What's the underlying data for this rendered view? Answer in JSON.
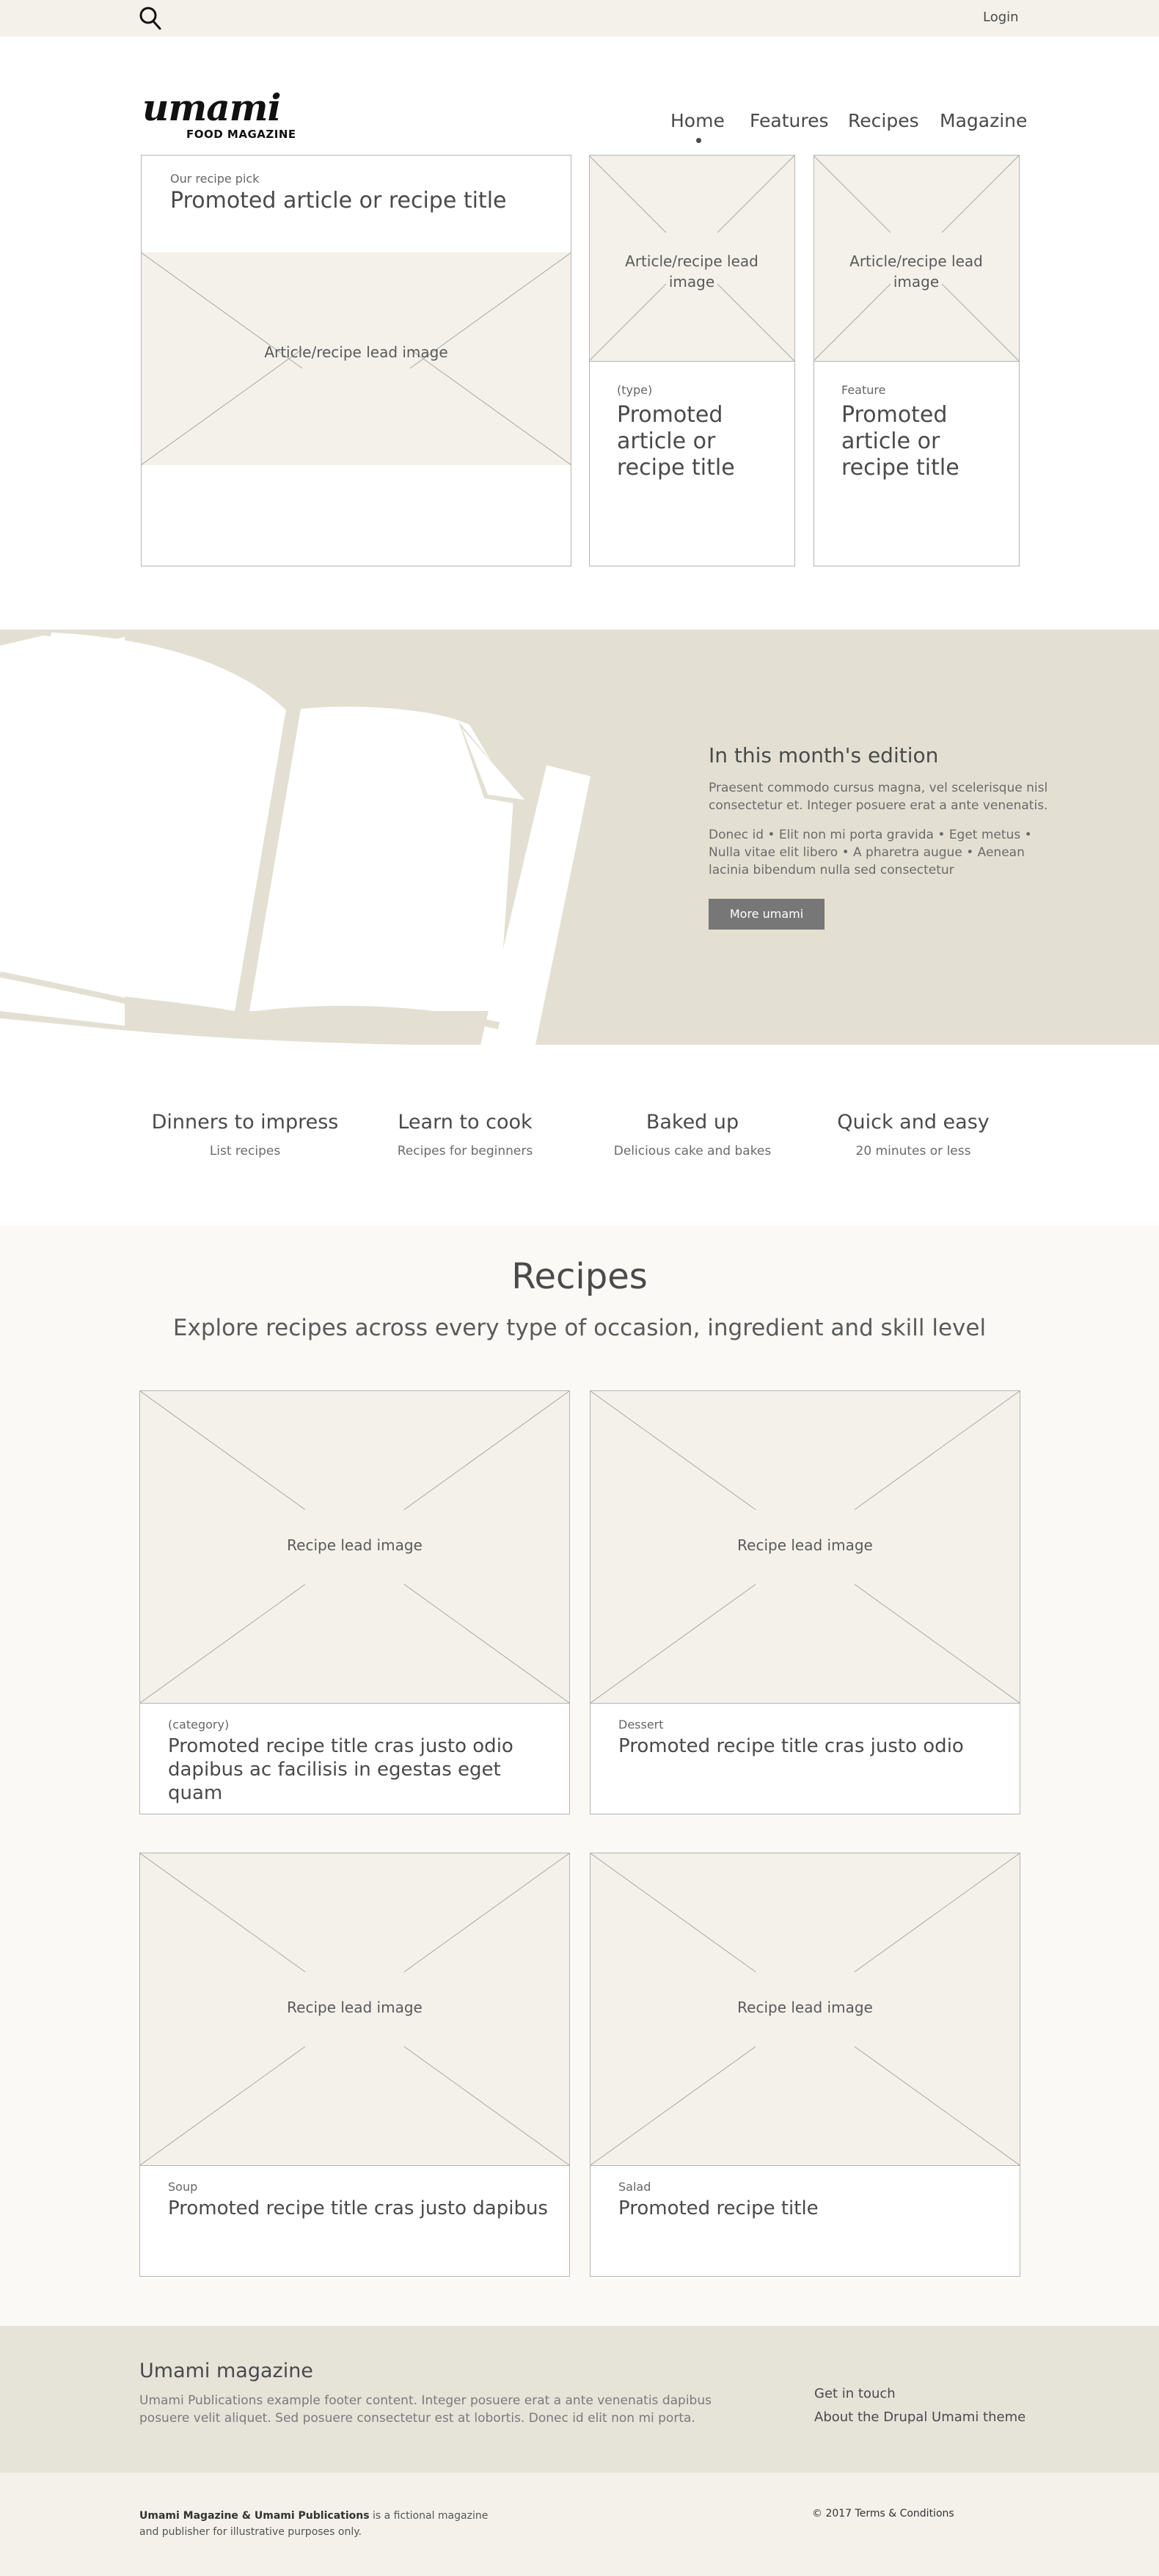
{
  "topbar": {
    "login": "Login",
    "search_icon": "search-icon"
  },
  "header": {
    "logo_word": "umami",
    "logo_sub": "FOOD MAGAZINE",
    "nav": [
      "Home",
      "Features",
      "Recipes",
      "Magazine"
    ],
    "active_nav": "Home"
  },
  "promoted": {
    "main": {
      "label": "Our recipe pick",
      "title": "Promoted article or recipe title",
      "image_label": "Article/recipe lead image"
    },
    "card1": {
      "image_label": "Article/recipe lead image",
      "label": "(type)",
      "title": "Promoted article or recipe title"
    },
    "card2": {
      "image_label": "Article/recipe lead image",
      "label": "Feature",
      "title": "Promoted article or recipe title"
    }
  },
  "edition": {
    "heading": "In this month's edition",
    "para1": "Praesent commodo cursus magna, vel scelerisque nisl consectetur et. Integer posuere erat a ante venenatis.",
    "para2": "Donec id • Elit non mi porta gravida • Eget metus • Nulla vitae elit libero • A pharetra augue • Aenean lacinia bibendum nulla sed consectetur",
    "button": "More umami"
  },
  "categories": [
    {
      "title": "Dinners to impress",
      "sub": "List recipes"
    },
    {
      "title": "Learn to cook",
      "sub": "Recipes for beginners"
    },
    {
      "title": "Baked up",
      "sub": "Delicious cake and bakes"
    },
    {
      "title": "Quick and easy",
      "sub": "20 minutes or less"
    }
  ],
  "recipes": {
    "heading": "Recipes",
    "subheading": "Explore recipes across every type of occasion, ingredient and skill level",
    "cards": [
      {
        "image_label": "Recipe lead image",
        "category": "(category)",
        "title": "Promoted recipe title cras justo odio dapibus ac facilisis in egestas eget quam"
      },
      {
        "image_label": "Recipe lead image",
        "category": "Dessert",
        "title": "Promoted recipe title cras justo odio"
      },
      {
        "image_label": "Recipe lead image",
        "category": "Soup",
        "title": "Promoted recipe title cras justo dapibus"
      },
      {
        "image_label": "Recipe lead image",
        "category": "Salad",
        "title": "Promoted recipe title"
      }
    ]
  },
  "footer": {
    "title": "Umami magazine",
    "text": "Umami Publications example footer content. Integer posuere erat a ante venenatis dapibus posuere velit aliquet. Sed posuere consectetur est at lobortis. Donec id elit non mi porta.",
    "links": [
      "Get in touch",
      "About the Drupal Umami theme"
    ]
  },
  "bottom": {
    "legal_bold": "Umami Magazine & Umami Publications",
    "legal_rest": " is a fictional magazine and publisher for illustrative purposes only.",
    "copyright": "© 2017 Terms & Conditions"
  },
  "colors": {
    "band": "#e3e0d3",
    "placeholder": "#f3f1ea",
    "button": "#777777",
    "footer": "#e6e3d9"
  }
}
